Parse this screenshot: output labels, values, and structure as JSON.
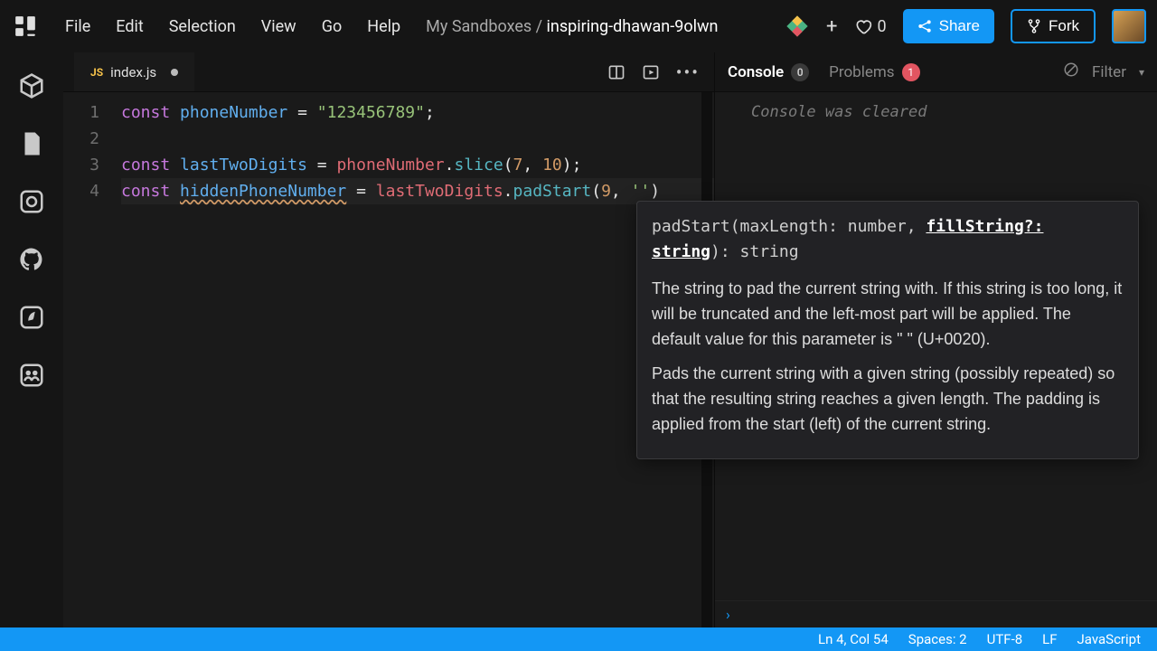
{
  "menu": {
    "file": "File",
    "edit": "Edit",
    "selection": "Selection",
    "view": "View",
    "go": "Go",
    "help": "Help"
  },
  "breadcrumb": {
    "parent": "My Sandboxes / ",
    "current": "inspiring-dhawan-9olwn"
  },
  "likes": "0",
  "share_label": "Share",
  "fork_label": "Fork",
  "tab": {
    "badge": "JS",
    "name": "index.js"
  },
  "code": {
    "l1": {
      "n": "1",
      "kw": "const",
      "ident": "phoneNumber",
      "rest": " = ",
      "str": "\"123456789\"",
      "semi": ";"
    },
    "l2": {
      "n": "2"
    },
    "l3": {
      "n": "3",
      "kw": "const",
      "ident": "lastTwoDigits",
      "eq": " = ",
      "obj": "phoneNumber",
      "dot": ".",
      "fn": "slice",
      "args_open": "(",
      "a1": "7",
      "comma": ", ",
      "a2": "10",
      "args_close": ");"
    },
    "l4": {
      "n": "4",
      "kw": "const",
      "ident": "hiddenPhoneNumber",
      "eq": " = ",
      "obj": "lastTwoDigits",
      "dot": ".",
      "fn": "padStart",
      "args_open": "(",
      "a1": "9",
      "comma": ", ",
      "a2": "''",
      "args_close": ")"
    }
  },
  "panel": {
    "console": "Console",
    "console_count": "0",
    "problems": "Problems",
    "problems_count": "1",
    "filter": "Filter",
    "cleared_msg": "Console was cleared",
    "prompt": "›"
  },
  "tooltip": {
    "sig_pre": "padStart(maxLength: number, ",
    "sig_active": "fillString?: string",
    "sig_post": "): string",
    "p1": "The string to pad the current string with. If this string is too long, it will be truncated and the left-most part will be applied. The default value for this parameter is \" \" (U+0020).",
    "p2": "Pads the current string with a given string (possibly repeated) so that the resulting string reaches a given length. The padding is applied from the start (left) of the current string."
  },
  "status": {
    "pos": "Ln 4, Col 54",
    "spaces": "Spaces: 2",
    "enc": "UTF-8",
    "eol": "LF",
    "lang": "JavaScript"
  }
}
